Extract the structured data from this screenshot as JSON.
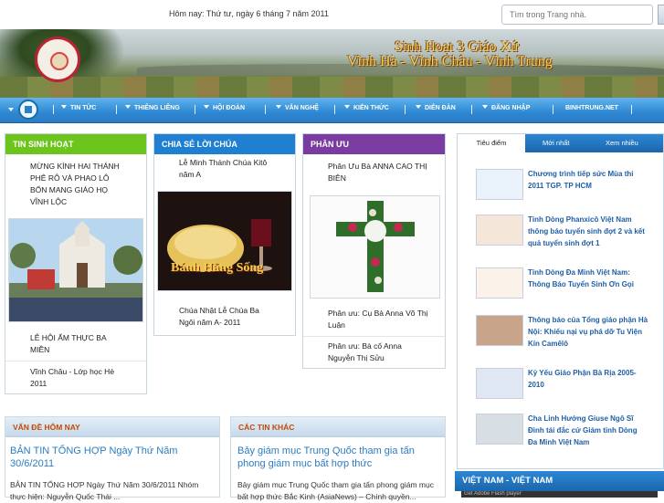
{
  "header": {
    "date": "Hôm nay: Thứ tư, ngày 6 tháng 7 năm 2011",
    "search_placeholder": "Tìm trong Trang nhà.",
    "title_line1": "Sinh Hoạt 3 Giáo Xứ",
    "title_line2": "Vĩnh Hà - Vĩnh Châu - Vĩnh Trung"
  },
  "nav": [
    "Tin Tức",
    "Thiêng Liêng",
    "Hội Đoàn",
    "Văn Nghệ",
    "Kiến Thức",
    "Diễn Đàn",
    "Đăng Nhập",
    "BINHTRUNG.NET"
  ],
  "col1": {
    "title": "Tin Sinh Hoạt",
    "items": [
      "MỪNG KÍNH HAI THÁNH PHÊ RÔ VÀ PHAO LÔ BỔN MANG GIÁO HỌ VĨNH LỘC",
      "LỄ HỘI ẨM THỰC BA MIỀN",
      "Vĩnh Châu - Lớp học Hè 2011"
    ]
  },
  "col2": {
    "title": "Chia Sẻ Lời Chúa",
    "items": [
      "Lễ Minh Thánh Chúa Kitô năm A",
      "Chúa Nhật Lễ Chúa Ba Ngôi năm A- 2011"
    ],
    "image_caption": "Bánh Hằng Sống"
  },
  "col3": {
    "title": "Phân Ưu",
    "items": [
      "Phân Ưu Bà ANNA CAO THỊ BIÊN",
      "Phân ưu: Cụ Bà Anna Võ Thị Luận",
      "Phân ưu: Bà cố Anna Nguyễn Thị Sửu"
    ]
  },
  "right": {
    "tabs": [
      "Tiêu điểm",
      "Mới nhất",
      "Xem nhiều"
    ],
    "news": [
      "Chương trình tiếp sức Mùa thi 2011 TGP. TP HCM",
      "Tỉnh Dòng Phanxicô Việt Nam thông báo tuyển sinh đợt 2 và kết quả tuyển sinh đợt 1",
      "Tỉnh Dòng Đa Minh Việt Nam: Thông Báo Tuyển Sinh Ơn Gọi",
      "Thông báo của Tổng giáo phận Hà Nội: Khiếu nại vụ phá dỡ Tu Viện Kín Camêlô",
      "Kỷ Yếu Giáo Phận Bà Rịa 2005-2010",
      "Cha Linh Hướng Giuse Ngô Sĩ Đình tái đắc cử Giám tỉnh Dòng Đa Minh Việt Nam"
    ],
    "section": "VIỆT NAM - VIỆT NAM",
    "flash": "Get Adobe Flash player"
  },
  "bottom_left": {
    "head": "Vấn đề hôm nay",
    "title": "BẢN TIN TỔNG HỢP Ngày Thứ Năm 30/6/2011",
    "body": "BẢN TIN TỔNG HỢP Ngày Thứ Năm 30/6/2011 Nhóm thực hiện: Nguyễn Quốc Thái ..."
  },
  "bottom_mid": {
    "head": "Các tin khác",
    "title": "Bảy giám mục Trung Quốc tham gia tấn phong giám mục bất hợp thức",
    "body": "Bảy giám mục Trung Quốc tham gia tấn phong giám mục bất hợp thức Bắc Kinh (AsiaNews) – Chính quyền..."
  }
}
